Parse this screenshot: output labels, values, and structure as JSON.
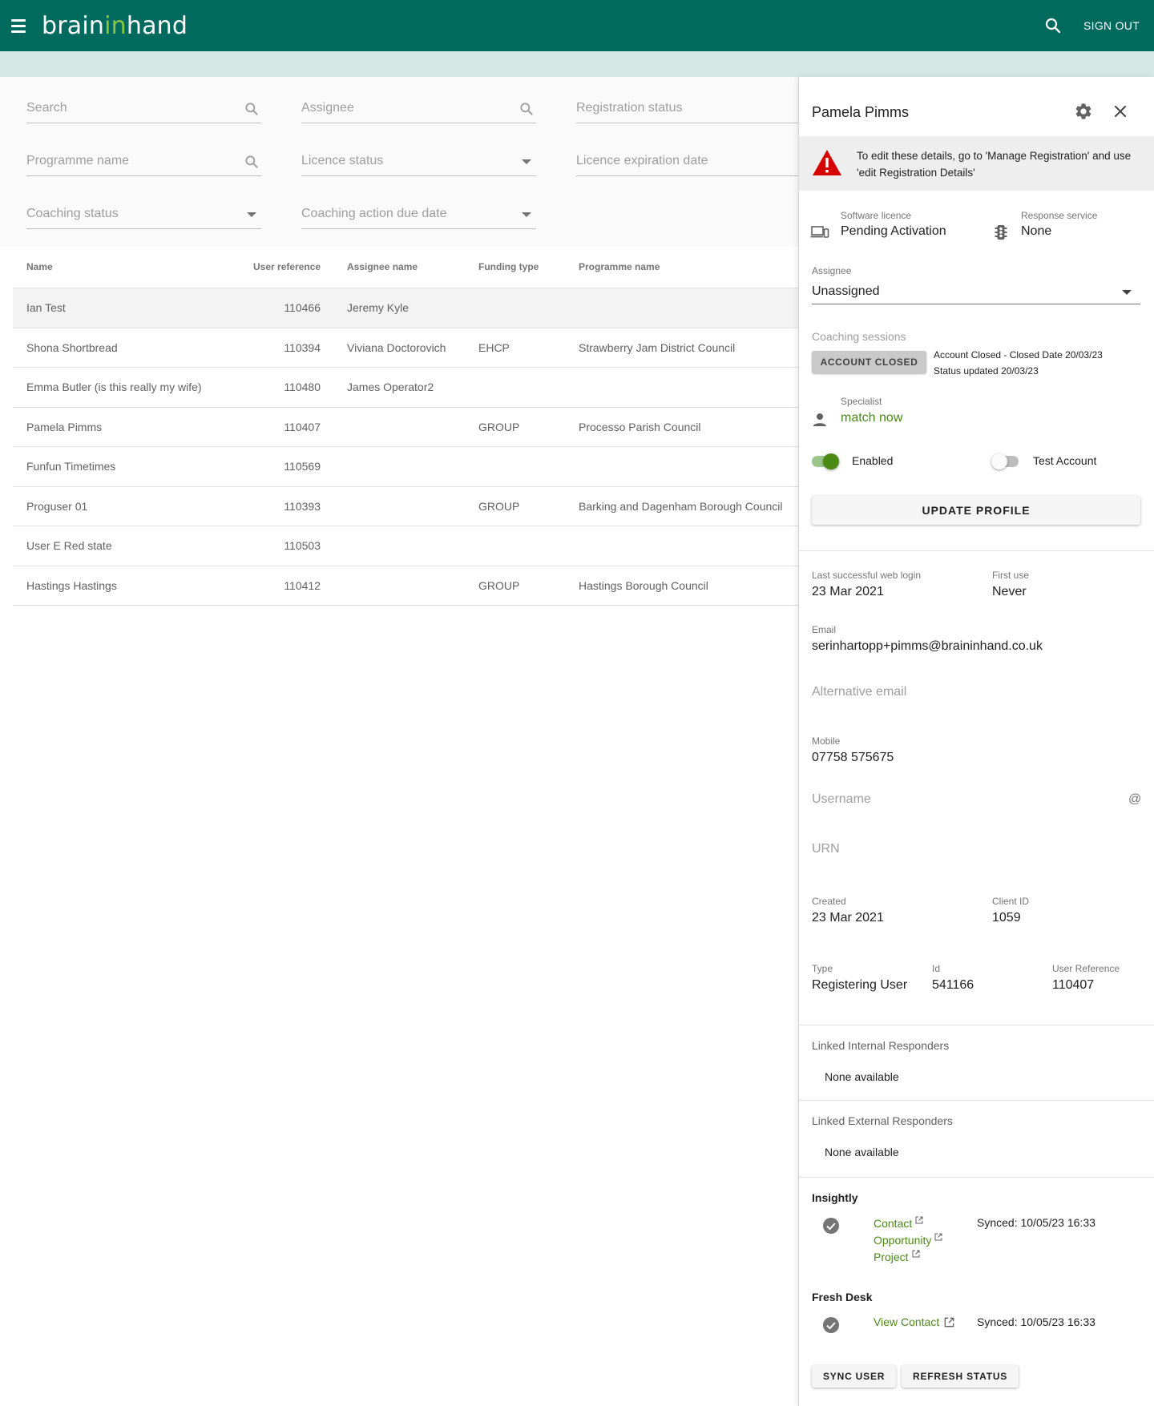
{
  "header": {
    "logo_part1": "brain",
    "logo_part2": "in",
    "logo_part3": "hand",
    "sign_out": "SIGN OUT"
  },
  "filters": {
    "search": "Search",
    "assignee": "Assignee",
    "registration_status": "Registration status",
    "programme_name": "Programme name",
    "licence_status": "Licence status",
    "licence_expiration_date": "Licence expiration date",
    "coaching_status": "Coaching status",
    "coaching_action_due_date": "Coaching action due date"
  },
  "table": {
    "columns": [
      "Name",
      "User reference",
      "Assignee name",
      "Funding type",
      "Programme name"
    ],
    "rows": [
      {
        "name": "Ian Test",
        "ref": "110466",
        "assignee": "Jeremy Kyle",
        "funding": "",
        "programme": ""
      },
      {
        "name": "Shona Shortbread",
        "ref": "110394",
        "assignee": "Viviana Doctorovich",
        "funding": "EHCP",
        "programme": "Strawberry Jam District Council"
      },
      {
        "name": "Emma Butler (is this really my wife)",
        "ref": "110480",
        "assignee": "James Operator2",
        "funding": "",
        "programme": ""
      },
      {
        "name": "Pamela Pimms",
        "ref": "110407",
        "assignee": "",
        "funding": "GROUP",
        "programme": "Processo Parish Council"
      },
      {
        "name": "Funfun Timetimes",
        "ref": "110569",
        "assignee": "",
        "funding": "",
        "programme": ""
      },
      {
        "name": "Proguser 01",
        "ref": "110393",
        "assignee": "",
        "funding": "GROUP",
        "programme": "Barking and Dagenham Borough Council"
      },
      {
        "name": "User E Red state",
        "ref": "110503",
        "assignee": "",
        "funding": "",
        "programme": ""
      },
      {
        "name": "Hastings Hastings",
        "ref": "110412",
        "assignee": "",
        "funding": "GROUP",
        "programme": "Hastings Borough Council"
      }
    ]
  },
  "panel": {
    "title": "Pamela Pimms",
    "warning": "To edit these details, go to 'Manage Registration' and use 'edit Registration Details'",
    "software_licence_label": "Software licence",
    "software_licence_value": "Pending Activation",
    "response_service_label": "Response service",
    "response_service_value": "None",
    "assignee_label": "Assignee",
    "assignee_value": "Unassigned",
    "coaching_label": "Coaching sessions",
    "account_closed_btn": "ACCOUNT CLOSED",
    "closed_line1": "Account Closed - Closed Date 20/03/23",
    "closed_line2": "Status updated 20/03/23",
    "specialist_label": "Specialist",
    "specialist_value": "match now",
    "enabled_label": "Enabled",
    "test_account_label": "Test Account",
    "enabled_on": true,
    "test_account_on": false,
    "update_profile": "UPDATE PROFILE",
    "last_login_label": "Last successful web login",
    "last_login_value": "23 Mar 2021",
    "first_use_label": "First use",
    "first_use_value": "Never",
    "email_label": "Email",
    "email_value": "serinhartopp+pimms@braininhand.co.uk",
    "alt_email_label": "Alternative email",
    "mobile_label": "Mobile",
    "mobile_value": "07758 575675",
    "username_label": "Username",
    "username_suffix": "@",
    "urn_label": "URN",
    "created_label": "Created",
    "created_value": "23 Mar 2021",
    "client_id_label": "Client ID",
    "client_id_value": "1059",
    "type_label": "Type",
    "type_value": "Registering User",
    "id_label": "Id",
    "id_value": "541166",
    "user_ref_label": "User Reference",
    "user_ref_value": "110407",
    "linked_internal_title": "Linked Internal Responders",
    "linked_internal_none": "None available",
    "linked_external_title": "Linked External Responders",
    "linked_external_none": "None available",
    "insightly_title": "Insightly",
    "insightly_links": [
      "Contact",
      "Opportunity",
      "Project"
    ],
    "insightly_synced": "Synced: 10/05/23 16:33",
    "freshdesk_title": "Fresh Desk",
    "freshdesk_link": "View Contact",
    "freshdesk_synced": "Synced: 10/05/23 16:33",
    "sync_user": "SYNC USER",
    "refresh_status": "REFRESH STATUS"
  },
  "colors": {
    "header_bg": "#006a5f",
    "subbar_bg": "#d3e8e3",
    "accent_green": "#4b8a14",
    "warning_red": "#d50000"
  }
}
